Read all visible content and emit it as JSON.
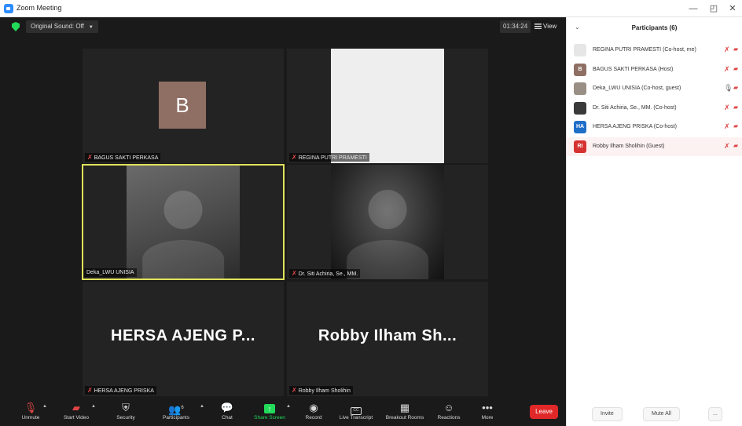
{
  "window": {
    "title": "Zoom Meeting",
    "minimize": "—",
    "restore": "◰",
    "close": "✕"
  },
  "meeting": {
    "original_sound": "Original Sound: Off",
    "timer": "01:34:24",
    "view_label": "View"
  },
  "tiles": [
    {
      "name": "BAGUS SAKTI PERKASA",
      "avatar_letter": "B",
      "avatar_color": "#8f6f64",
      "muted": true
    },
    {
      "name": "REGINA PUTRI PRAMESTI",
      "muted": true
    },
    {
      "name": "Deka_LWU UNISIA",
      "muted": false,
      "active_speaker": true
    },
    {
      "name": "Dr. Siti Achiria, Se., MM.",
      "muted": true
    },
    {
      "name": "HERSA AJENG PRISKA",
      "display_name": "HERSA AJENG P...",
      "muted": true
    },
    {
      "name": "Robby Ilham Sholihin",
      "display_name": "Robby Ilham Sh...",
      "muted": true
    }
  ],
  "toolbar": {
    "unmute": "Unmute",
    "start_video": "Start Video",
    "security": "Security",
    "participants": "Participants",
    "participants_count": "6",
    "chat": "Chat",
    "share_screen": "Share Screen",
    "record": "Record",
    "live_transcript": "Live Transcript",
    "breakout_rooms": "Breakout Rooms",
    "reactions": "Reactions",
    "more": "More",
    "leave": "Leave"
  },
  "panel": {
    "title": "Participants (6)",
    "participants": [
      {
        "name": "REGINA PUTRI PRAMESTI (Co-host, me)",
        "avatar": "",
        "avatar_color": "#e6e6e6",
        "mic": "muted",
        "highlight": false
      },
      {
        "name": "BAGUS SAKTI PERKASA (Host)",
        "avatar": "B",
        "avatar_color": "#8f6f64",
        "mic": "muted",
        "highlight": false
      },
      {
        "name": "Deka_LWU UNISIA (Co-host, guest)",
        "avatar": "",
        "avatar_color": "#9a8f84",
        "mic": "on",
        "highlight": false
      },
      {
        "name": "Dr. Siti Achiria, Se., MM. (Co-host)",
        "avatar": "",
        "avatar_color": "#3a3a3a",
        "mic": "muted",
        "highlight": false
      },
      {
        "name": "HERSA AJENG PRISKA (Co-host)",
        "avatar": "HA",
        "avatar_color": "#1f6fc9",
        "mic": "muted",
        "highlight": false
      },
      {
        "name": "Robby Ilham Sholihin (Guest)",
        "avatar": "RI",
        "avatar_color": "#d63232",
        "mic": "muted",
        "highlight": true
      }
    ],
    "invite": "Invite",
    "mute_all": "Mute All",
    "more": "..."
  }
}
